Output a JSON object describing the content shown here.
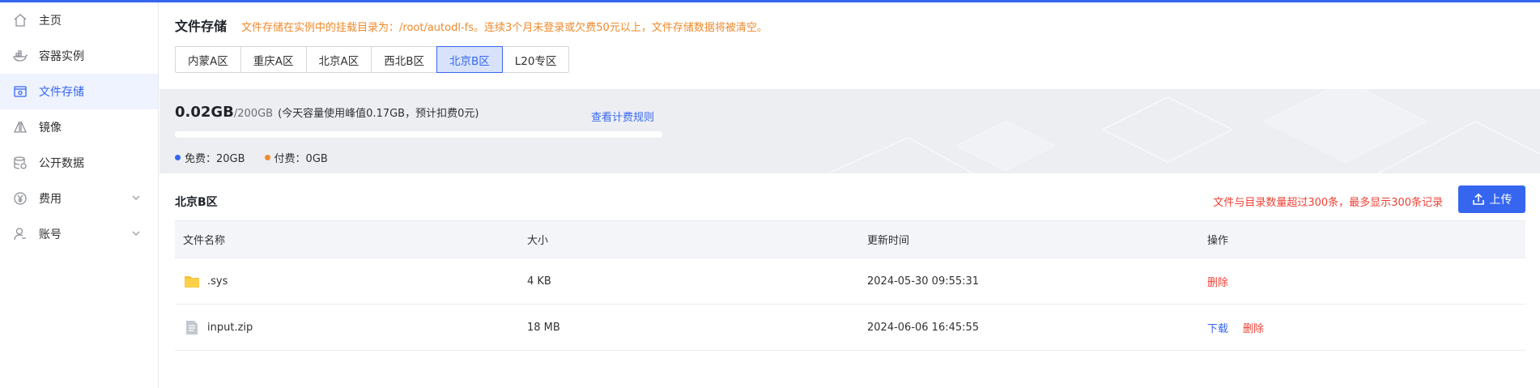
{
  "sidebar": {
    "items": [
      {
        "label": "主页",
        "icon": "home-icon"
      },
      {
        "label": "容器实例",
        "icon": "container-icon"
      },
      {
        "label": "文件存储",
        "icon": "storage-icon",
        "active": true
      },
      {
        "label": "镜像",
        "icon": "image-icon"
      },
      {
        "label": "公开数据",
        "icon": "database-icon"
      },
      {
        "label": "费用",
        "icon": "yen-icon",
        "expandable": true
      },
      {
        "label": "账号",
        "icon": "user-icon",
        "expandable": true
      }
    ]
  },
  "header": {
    "title": "文件存储",
    "notice": "文件存储在实例中的挂载目录为：/root/autodl-fs。连续3个月未登录或欠费50元以上，文件存储数据将被清空。"
  },
  "regions": {
    "tabs": [
      "内蒙A区",
      "重庆A区",
      "北京A区",
      "西北B区",
      "北京B区",
      "L20专区"
    ],
    "selected": "北京B区"
  },
  "usage": {
    "used": "0.02GB",
    "total": "/200GB",
    "peak_note": "(今天容量使用峰值0.17GB，预计扣费0元)",
    "rules_link": "查看计费规则",
    "progress_fraction": 0.0001,
    "free_label": "免费：20GB",
    "paid_label": "付费：0GB",
    "free_color": "#3666f0",
    "paid_color": "#f0892b"
  },
  "files_section": {
    "title": "北京B区",
    "limit_warning": "文件与目录数量超过300条，最多显示300条记录",
    "upload_label": "上传"
  },
  "table": {
    "headers": {
      "name": "文件名称",
      "size": "大小",
      "updated": "更新时间",
      "actions": "操作"
    },
    "rows": [
      {
        "name": ".sys",
        "type": "folder-icon",
        "size": "4 KB",
        "updated": "2024-05-30 09:55:31",
        "download": "",
        "delete": "删除"
      },
      {
        "name": "input.zip",
        "type": "file-icon",
        "size": "18 MB",
        "updated": "2024-06-06 16:45:55",
        "download": "下载",
        "delete": "删除"
      }
    ]
  },
  "colors": {
    "accent": "#3666f0",
    "warning": "#f0892b",
    "danger": "#f04134"
  }
}
